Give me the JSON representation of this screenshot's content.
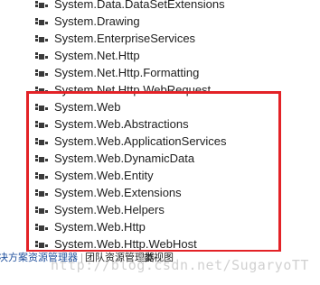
{
  "references": [
    {
      "label": "System.Data.DataSetExtensions"
    },
    {
      "label": "System.Drawing"
    },
    {
      "label": "System.EnterpriseServices"
    },
    {
      "label": "System.Net.Http"
    },
    {
      "label": "System.Net.Http.Formatting"
    },
    {
      "label": "System.Net.Http.WebRequest"
    },
    {
      "label": "System.Web"
    },
    {
      "label": "System.Web.Abstractions"
    },
    {
      "label": "System.Web.ApplicationServices"
    },
    {
      "label": "System.Web.DynamicData"
    },
    {
      "label": "System.Web.Entity"
    },
    {
      "label": "System.Web.Extensions"
    },
    {
      "label": "System.Web.Helpers"
    },
    {
      "label": "System.Web.Http"
    },
    {
      "label": "System.Web.Http.WebHost"
    }
  ],
  "tabs": [
    {
      "label": "决方案资源管理器"
    },
    {
      "label": "团队资源管理器"
    },
    {
      "label": "类视图"
    }
  ],
  "watermark": "http://blog.csdn.net/SugaryoTT",
  "colors": {
    "highlight": "#e32227",
    "icon": "#3a3a3a",
    "active_tab": "#1e4f9c"
  }
}
